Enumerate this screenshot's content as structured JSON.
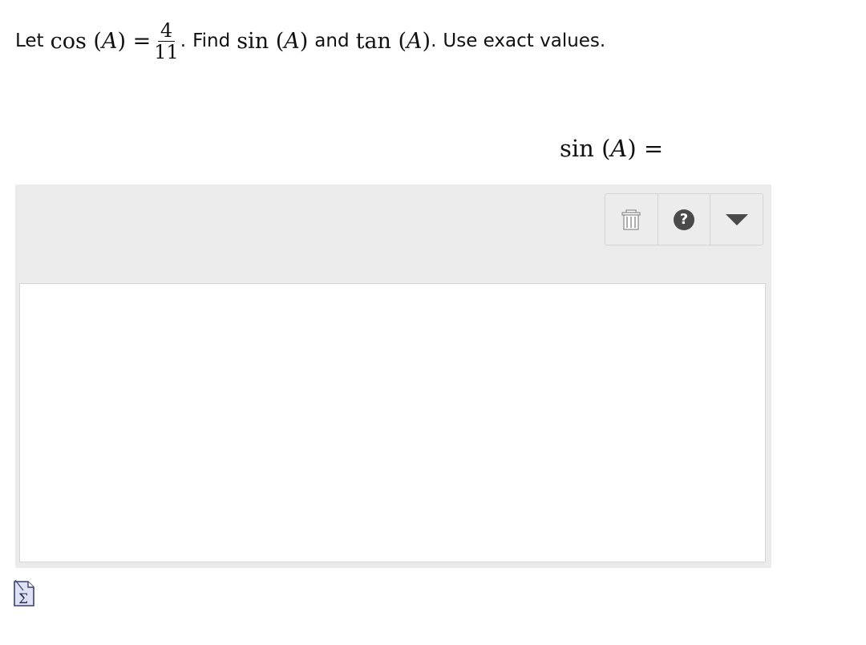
{
  "problem": {
    "intro": "Let",
    "cos_fn": "cos",
    "paren_open": "(",
    "variable": "A",
    "paren_close": ")",
    "equals": "=",
    "fraction": {
      "numerator": "4",
      "denominator": "11"
    },
    "period": ".",
    "find": "Find",
    "sin_fn": "sin",
    "and": "and",
    "tan_fn": "tan",
    "instruction": "Use exact values."
  },
  "answer_label": {
    "fn": "sin",
    "paren_open": "(",
    "variable": "A",
    "paren_close": ")",
    "equals": "="
  },
  "toolbar": {
    "trash_icon": "trash-icon",
    "help_label": "?",
    "dropdown_icon": "caret-down-icon"
  },
  "answer_input": {
    "value": ""
  },
  "equation_editor": {
    "icon": "sigma-icon"
  },
  "colors": {
    "panel_bg": "#ebebeb",
    "toolbar_border": "#d4d4d4",
    "icon_dark": "#4a4a4a",
    "text": "#111111"
  }
}
